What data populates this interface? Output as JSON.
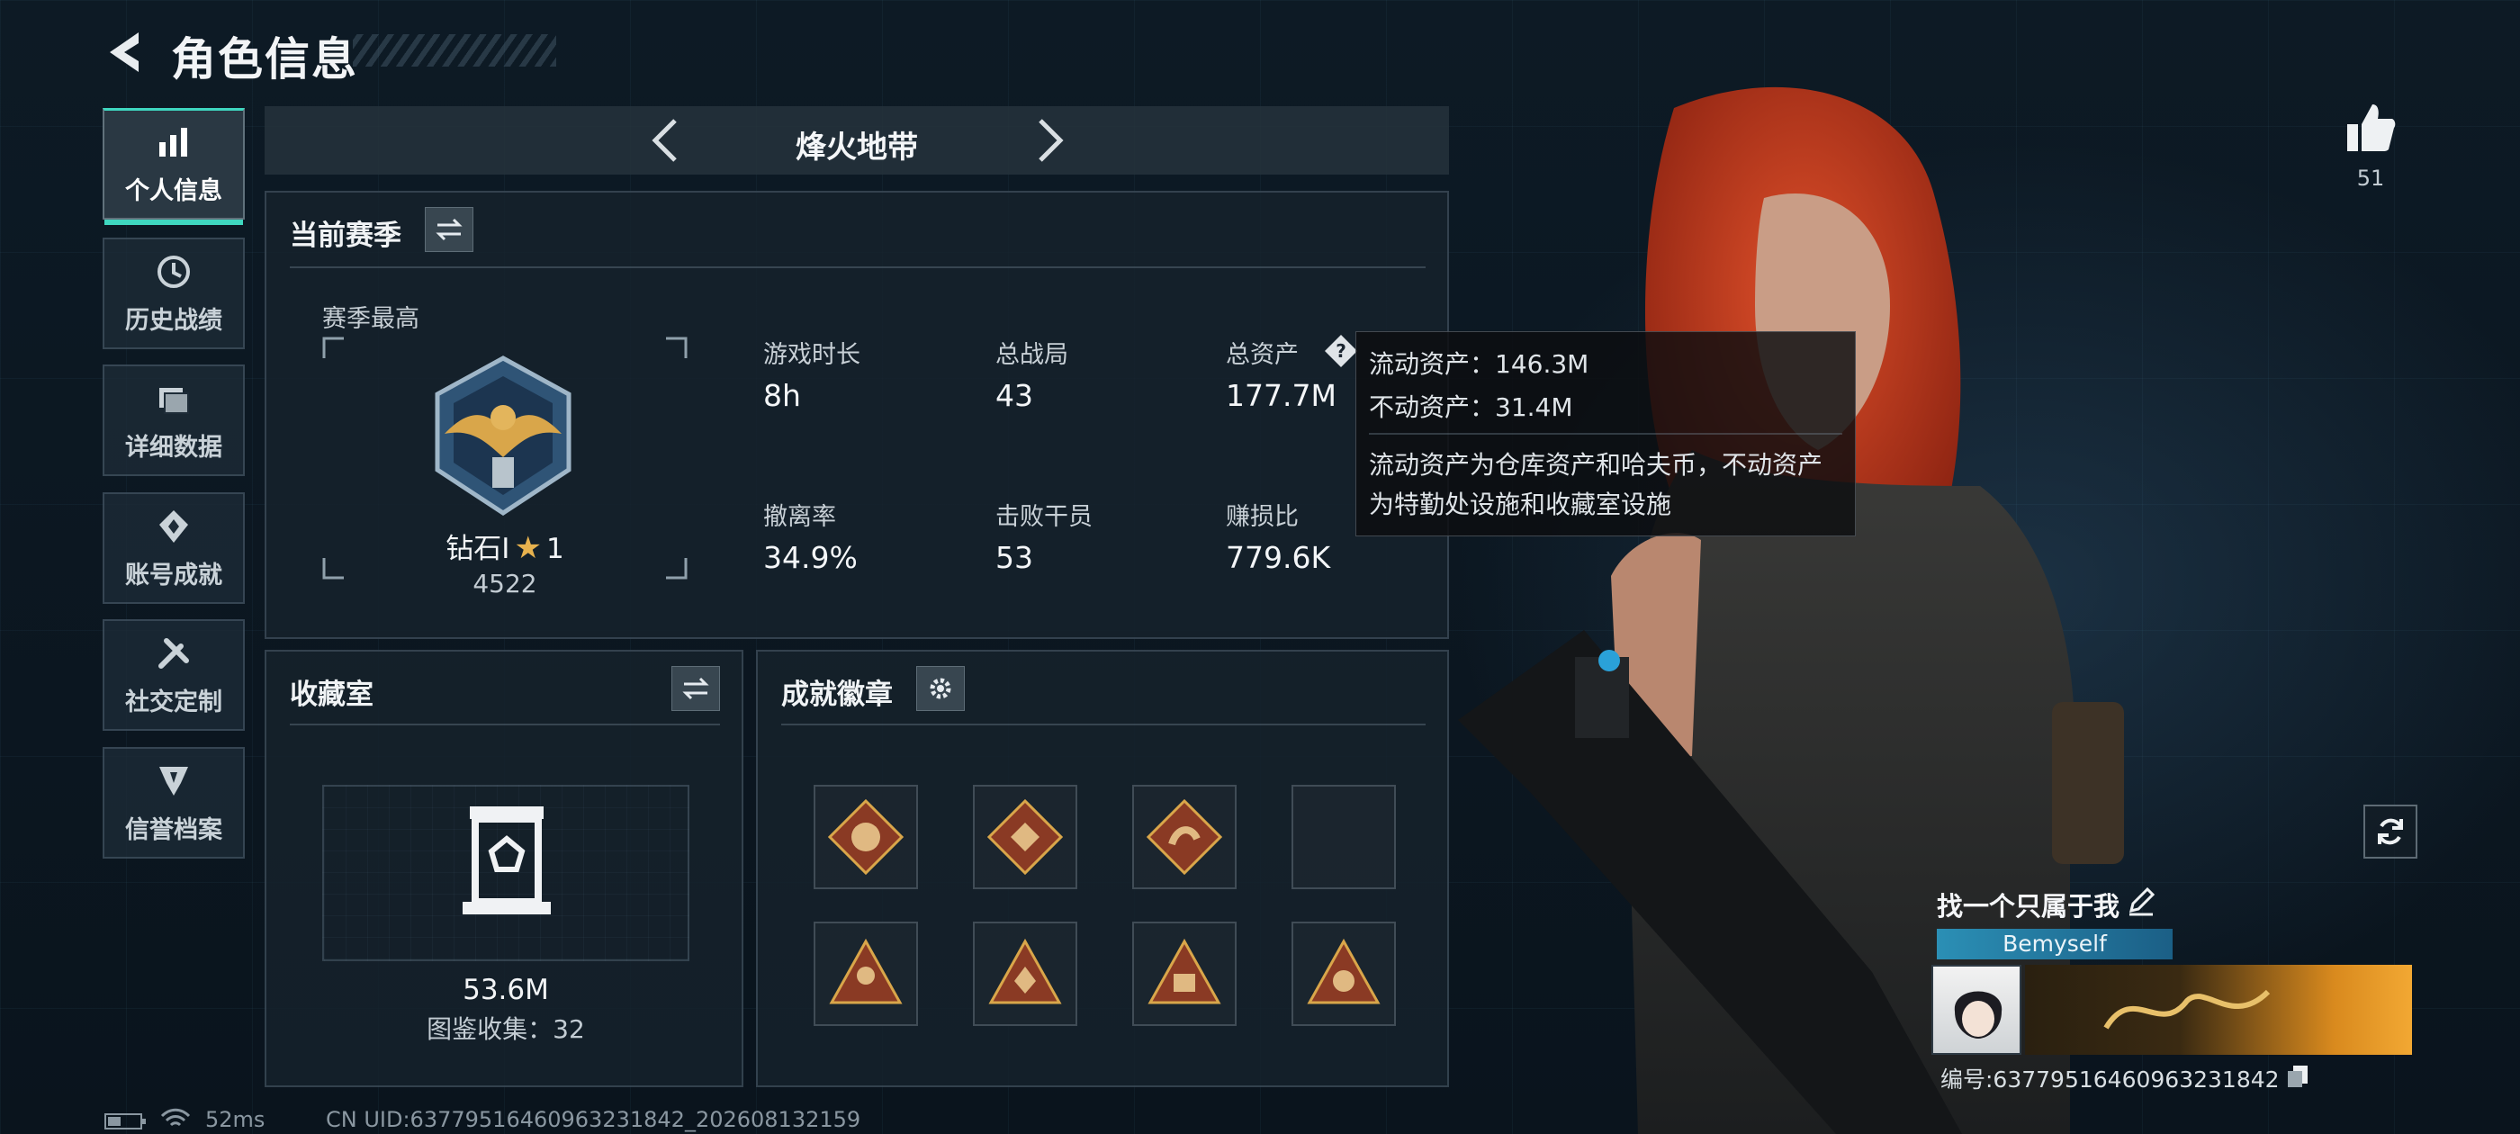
{
  "header": {
    "title": "角色信息"
  },
  "sidebar": {
    "items": [
      {
        "label": "个人信息",
        "icon": "bar-chart-icon"
      },
      {
        "label": "历史战绩",
        "icon": "history-clock-icon"
      },
      {
        "label": "详细数据",
        "icon": "folder-icon"
      },
      {
        "label": "账号成就",
        "icon": "achievement-icon"
      },
      {
        "label": "社交定制",
        "icon": "wrench-icon"
      },
      {
        "label": "信誉档案",
        "icon": "shield-icon"
      }
    ]
  },
  "map_selector": {
    "name": "烽火地带"
  },
  "season": {
    "title": "当前赛季",
    "best_label": "赛季最高",
    "rank_name": "钻石I",
    "rank_stars": "1",
    "rank_score": "4522",
    "stats": [
      {
        "label": "游戏时长",
        "value": "8h"
      },
      {
        "label": "总战局",
        "value": "43"
      },
      {
        "label": "总资产",
        "value": "177.7M"
      },
      {
        "label": "撤离率",
        "value": "34.9%"
      },
      {
        "label": "击败干员",
        "value": "53"
      },
      {
        "label": "赚损比",
        "value": "779.6K"
      }
    ]
  },
  "tooltip": {
    "liquid": "流动资产：146.3M",
    "fixed": "不动资产：31.4M",
    "desc1": "流动资产为仓库资产和哈夫币，不动资产",
    "desc2": "为特勤处设施和收藏室设施"
  },
  "collection": {
    "title": "收藏室",
    "value": "53.6M",
    "count_label": "图鉴收集：32"
  },
  "achievements": {
    "title": "成就徽章",
    "badges": 7
  },
  "profile": {
    "likes": "51",
    "name": "找一个只属于我",
    "tag": "Bemyself",
    "id_label": "编号:63779516460963231842"
  },
  "status": {
    "ping": "52ms",
    "uid": "CN UID:63779516460963231842_202608132159"
  },
  "colors": {
    "accent": "#3fd7c0",
    "badge": "#8a3a24",
    "gold": "#d9a64a"
  }
}
